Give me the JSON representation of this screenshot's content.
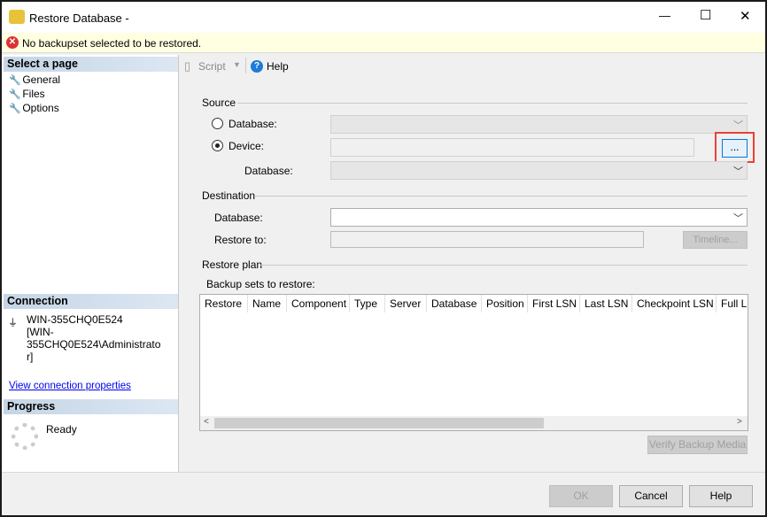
{
  "window": {
    "title": "Restore Database -",
    "minimize": "—",
    "maximize": "☐",
    "close": "✕"
  },
  "message": "No backupset selected to be restored.",
  "left": {
    "select_page": "Select a page",
    "pages": [
      "General",
      "Files",
      "Options"
    ],
    "connection_header": "Connection",
    "server": "WIN-355CHQ0E524",
    "user_line1": "[WIN-355CHQ0E524\\Administrato",
    "user_line2": "r]",
    "view_connection": "View connection properties",
    "progress_header": "Progress",
    "progress_status": "Ready"
  },
  "toolbar": {
    "script": "Script",
    "help": "Help"
  },
  "source": {
    "label": "Source",
    "database_radio": "Database:",
    "device_radio": "Device:",
    "selected": "Device",
    "browse": "...",
    "database_label": "Database:"
  },
  "destination": {
    "label": "Destination",
    "database_label": "Database:",
    "database_value": "",
    "restore_to_label": "Restore to:",
    "restore_to_value": "",
    "timeline": "Timeline..."
  },
  "plan": {
    "label": "Restore plan",
    "backup_sets": "Backup sets to restore:",
    "columns": [
      "Restore",
      "Name",
      "Component",
      "Type",
      "Server",
      "Database",
      "Position",
      "First LSN",
      "Last LSN",
      "Checkpoint LSN",
      "Full LSN"
    ],
    "rows": []
  },
  "verify": "Verify Backup Media",
  "buttons": {
    "ok": "OK",
    "cancel": "Cancel",
    "help": "Help"
  },
  "colors": {
    "highlight": "#e8413a",
    "info_bg": "#ffffe1",
    "link": "#0000ee"
  }
}
